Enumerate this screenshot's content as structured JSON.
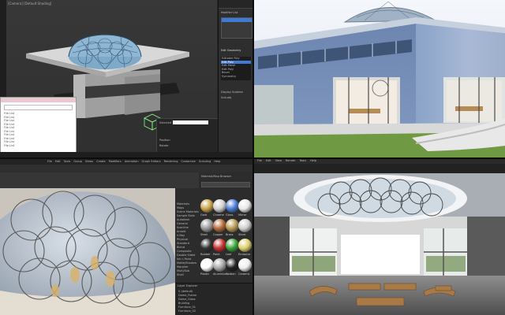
{
  "viewport_tl": {
    "title_bar": "[Camera] [Default Shading]",
    "dialog_rows": [
      "File List",
      "File List",
      "File List",
      "File List",
      "File List",
      "File List",
      "File List",
      "File List",
      "File List",
      "File List"
    ],
    "right_panel": {
      "header": "Modifier List",
      "group_label": "Edit Geometry",
      "list_items": [
        "Editable Poly",
        "Edit Poly",
        "Edit Mesh",
        "Edit Poly",
        "Bevel",
        "Symmetry"
      ],
      "fields": [
        "Display Subtree",
        "Sub-obj"
      ]
    },
    "bottom_bar": [
      "Selected",
      "Position",
      "Rotate"
    ]
  },
  "render_tr": {},
  "viewport_bl": {
    "menu": [
      "File",
      "Edit",
      "Tools",
      "Group",
      "Views",
      "Create",
      "Modifiers",
      "Animation",
      "Graph Editors",
      "Rendering",
      "Customize",
      "Scripting",
      "Help"
    ],
    "material_browser": {
      "title": "Material/Map Browser",
      "search": "Search by Name ...",
      "categories": [
        "Materials",
        "Maps",
        "Scene Materials",
        "Sample Slots",
        "Autodesk",
        "General",
        "Scanline",
        "Arnold",
        "V-Ray",
        "Physical",
        "Standard",
        "Blend",
        "Composite",
        "Double Sided",
        "Ink n Paint",
        "Matte/Shadow",
        "Morpher",
        "Multi/Sub",
        "Shell"
      ],
      "materials": [
        "Gold",
        "Chrome",
        "Glass",
        "Mirror",
        "Steel",
        "Copper",
        "Brass",
        "Silver",
        "Rubber",
        "Paint",
        "Leaf",
        "Emissive",
        "Plastic",
        "Aluminium",
        "Carbon",
        "Ceramic"
      ],
      "layer_panel_title": "Layer Explorer",
      "layers": [
        "0 (default)",
        "Dome_Frame",
        "Dome_Glass",
        "Building",
        "Furniture_01",
        "Furniture_02",
        "Lights",
        "Cameras",
        "Ground",
        "Environment"
      ]
    }
  },
  "render_br": {
    "menu": [
      "File",
      "Edit",
      "View",
      "Render",
      "Tools",
      "Help"
    ]
  },
  "colors": {
    "panel_dark": "#2b2b2b",
    "viewport_bg": "#3b3b3b",
    "accent_blue": "#3d7bd6"
  }
}
